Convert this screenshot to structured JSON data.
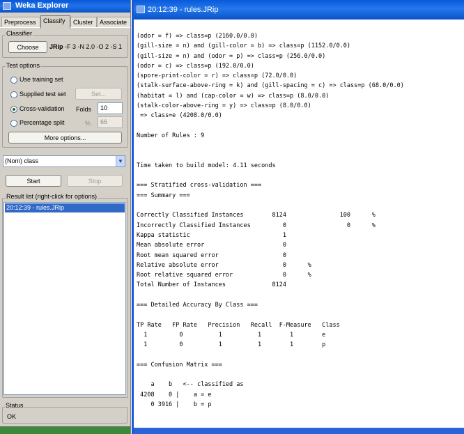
{
  "explorer": {
    "title": "Weka Explorer",
    "tabs": [
      "Preprocess",
      "Classify",
      "Cluster",
      "Associate"
    ],
    "active_tab": "Classify",
    "classifier": {
      "group_label": "Classifier",
      "choose_label": "Choose",
      "name": "JRip",
      "options": "-F 3 -N 2.0 -O 2 -S 1"
    },
    "test_options": {
      "group_label": "Test options",
      "use_training_set": "Use training set",
      "supplied_test_set": "Supplied test set",
      "set_label": "Set...",
      "cross_validation": "Cross-validation",
      "folds_label": "Folds",
      "folds_value": "10",
      "percentage_split": "Percentage split",
      "percent_symbol": "%",
      "percent_value": "66",
      "selected": "cross_validation",
      "more_options_label": "More options..."
    },
    "class_select": {
      "value": "(Nom) class",
      "arrow": "chevron-down-icon"
    },
    "start_label": "Start",
    "stop_label": "Stop",
    "result_list": {
      "label": "Result list (right-click for options)",
      "items": [
        "20:12:39 - rules.JRip"
      ]
    },
    "status": {
      "label": "Status",
      "text": "OK"
    }
  },
  "output": {
    "title": "20:12:39 - rules.JRip",
    "lines": [
      "(odor = f) => class=p (2160.0/0.0)",
      "(gill-size = n) and (gill-color = b) => class=p (1152.0/0.0)",
      "(gill-size = n) and (odor = p) => class=p (256.0/0.0)",
      "(odor = c) => class=p (192.0/0.0)",
      "(spore-print-color = r) => class=p (72.0/0.0)",
      "(stalk-surface-above-ring = k) and (gill-spacing = c) => class=p (68.0/0.0)",
      "(habitat = l) and (cap-color = w) => class=p (8.0/0.0)",
      "(stalk-color-above-ring = y) => class=p (8.0/0.0)",
      " => class=e (4208.0/0.0)",
      "",
      "Number of Rules : 9",
      "",
      "",
      "Time taken to build model: 4.11 seconds",
      "",
      "=== Stratified cross-validation ===",
      "=== Summary ===",
      "",
      "Correctly Classified Instances        8124               100      %",
      "Incorrectly Classified Instances         0                 0      %",
      "Kappa statistic                          1",
      "Mean absolute error                      0",
      "Root mean squared error                  0",
      "Relative absolute error                  0      %",
      "Root relative squared error              0      %",
      "Total Number of Instances             8124",
      "",
      "=== Detailed Accuracy By Class ===",
      "",
      "TP Rate   FP Rate   Precision   Recall  F-Measure   Class",
      "  1         0          1          1        1        e",
      "  1         0          1          1        1        p",
      "",
      "=== Confusion Matrix ===",
      "",
      "    a    b   <-- classified as",
      " 4208    0 |    a = e",
      "    0 3916 |    b = p"
    ]
  }
}
